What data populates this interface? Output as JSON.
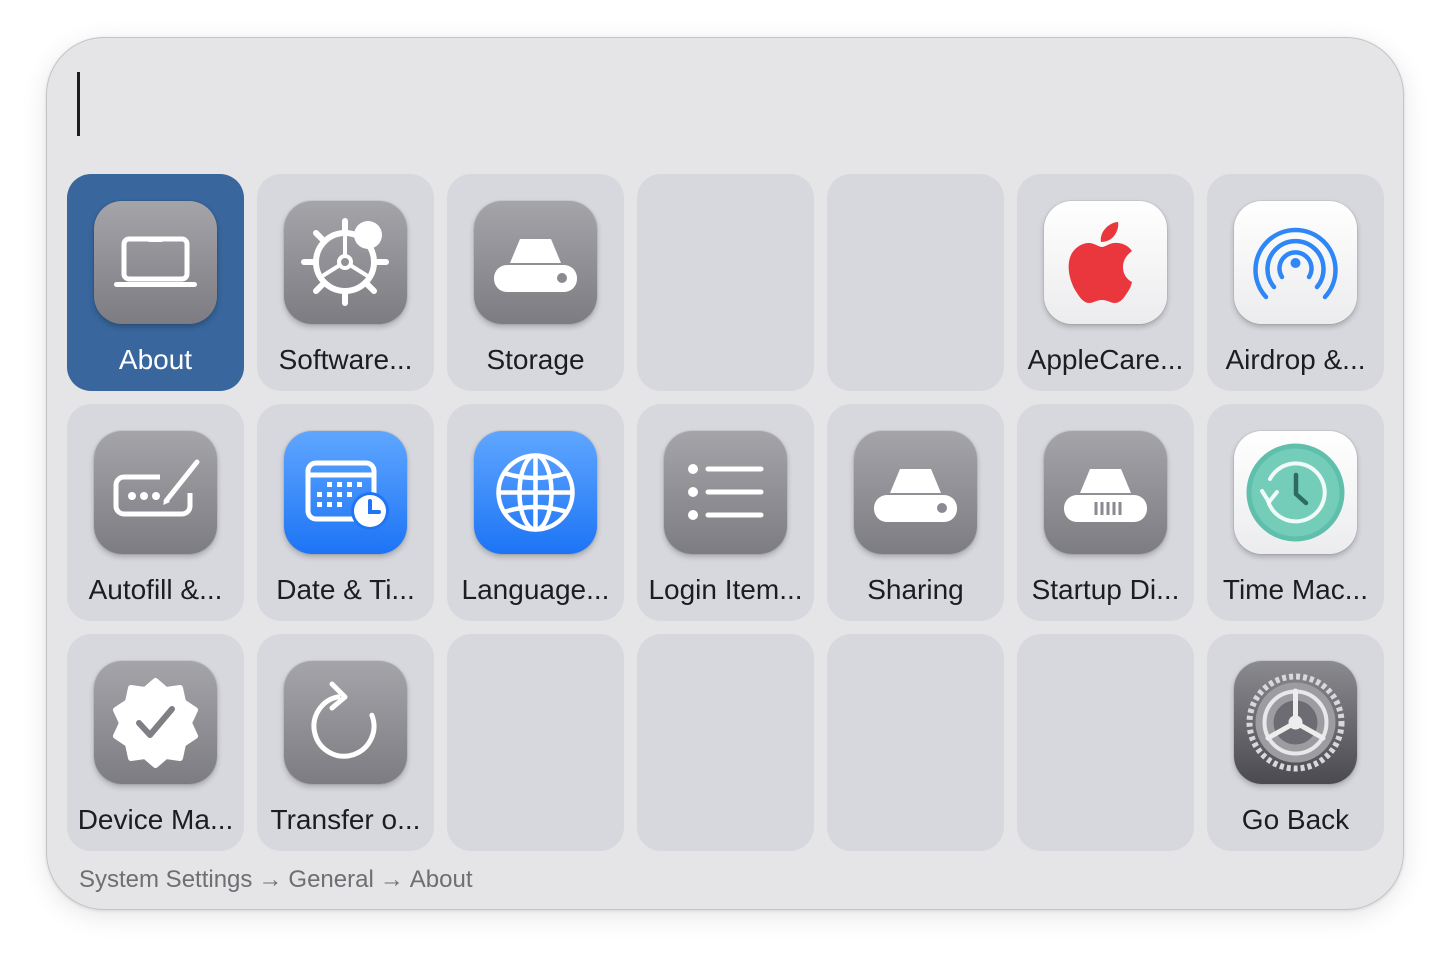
{
  "search": {
    "value": ""
  },
  "grid": {
    "tiles": [
      {
        "label": "About",
        "icon": "laptop-icon",
        "selected": true
      },
      {
        "label": "Software...",
        "icon": "software-update-gear-icon"
      },
      {
        "label": "Storage",
        "icon": "drive-icon"
      },
      {
        "label": ""
      },
      {
        "label": ""
      },
      {
        "label": "AppleCare...",
        "icon": "apple-logo-icon"
      },
      {
        "label": "Airdrop &...",
        "icon": "airdrop-icon"
      },
      {
        "label": "Autofill &...",
        "icon": "password-field-icon"
      },
      {
        "label": "Date & Ti...",
        "icon": "calendar-clock-icon"
      },
      {
        "label": "Language...",
        "icon": "globe-icon"
      },
      {
        "label": "Login Item...",
        "icon": "list-icon"
      },
      {
        "label": "Sharing",
        "icon": "drive-icon"
      },
      {
        "label": "Startup Di...",
        "icon": "startup-disk-icon"
      },
      {
        "label": "Time Mac...",
        "icon": "time-machine-icon"
      },
      {
        "label": "Device Ma...",
        "icon": "checkmark-seal-icon"
      },
      {
        "label": "Transfer o...",
        "icon": "reset-arrow-icon"
      },
      {
        "label": ""
      },
      {
        "label": ""
      },
      {
        "label": ""
      },
      {
        "label": ""
      },
      {
        "label": "Go Back",
        "icon": "system-settings-gear-icon"
      }
    ]
  },
  "breadcrumb": {
    "items": [
      "System Settings",
      "General",
      "About"
    ],
    "separator": "→"
  },
  "colors": {
    "panel_background": "#e5e5e7",
    "tile_background": "#d6d8de",
    "selected_tile": "#38669d",
    "label_text": "#1d1d1f",
    "breadcrumb_text": "#6e6e73"
  }
}
